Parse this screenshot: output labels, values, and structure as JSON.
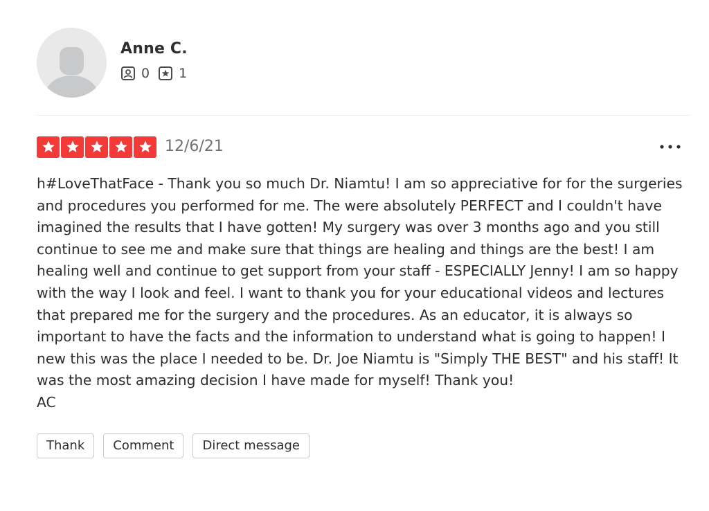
{
  "user": {
    "name": "Anne C.",
    "friends_count": "0",
    "reviews_count": "1",
    "avatar_icon": "default-user-avatar",
    "friends_icon": "friends-icon",
    "reviews_icon": "reviews-star-icon"
  },
  "review": {
    "rating": 5,
    "rating_max": 5,
    "star_color": "#f43939",
    "date": "12/6/21",
    "more_icon": "more-options-icon",
    "text": "h#LoveThatFace - Thank you so much Dr. Niamtu! I am so appreciative for for the surgeries and procedures you performed for me. The were absolutely PERFECT and I couldn't have imagined the results that I have gotten! My surgery was over 3 months ago and you still continue to see me and make sure that things are healing and things are the best! I am healing well and continue to get support from your staff - ESPECIALLY Jenny! I am so happy with the way I look and feel. I want to thank you for your educational videos and lectures that prepared me for the surgery and the procedures. As an educator, it is always so important to have the facts and the information to understand what is going to happen! I new this was the place I needed to be. Dr. Joe Niamtu is \"Simply THE BEST\" and his staff! It was the most amazing decision I have made for myself! Thank you!\nAC"
  },
  "actions": {
    "thank_label": "Thank",
    "comment_label": "Comment",
    "message_label": "Direct message"
  }
}
